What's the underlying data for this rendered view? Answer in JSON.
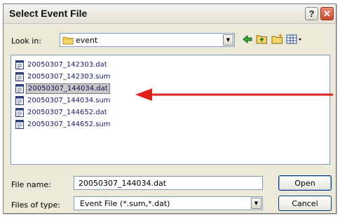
{
  "dialog": {
    "title": "Select Event File",
    "help_label": "?",
    "close_label": "✕"
  },
  "toolbar": {
    "look_in_label": "Look in:",
    "look_in_value": "event",
    "icons": [
      "back-icon",
      "up-folder-icon",
      "new-folder-icon",
      "view-menu-icon"
    ]
  },
  "files": [
    {
      "name": "20050307_142303.dat",
      "selected": false
    },
    {
      "name": "20050307_142303.sum",
      "selected": false
    },
    {
      "name": "20050307_144034.dat",
      "selected": true
    },
    {
      "name": "20050307_144034.sum",
      "selected": false
    },
    {
      "name": "20050307_144652.dat",
      "selected": false
    },
    {
      "name": "20050307_144652.sum",
      "selected": false
    }
  ],
  "file_name": {
    "label": "File name:",
    "value": "20050307_144034.dat"
  },
  "file_type": {
    "label": "Files of type:",
    "value": "Event File (*.sum,*.dat)"
  },
  "buttons": {
    "open": "Open",
    "cancel": "Cancel"
  },
  "colors": {
    "annotation_arrow": "#e0201a",
    "selection": "#c9c9c9"
  }
}
